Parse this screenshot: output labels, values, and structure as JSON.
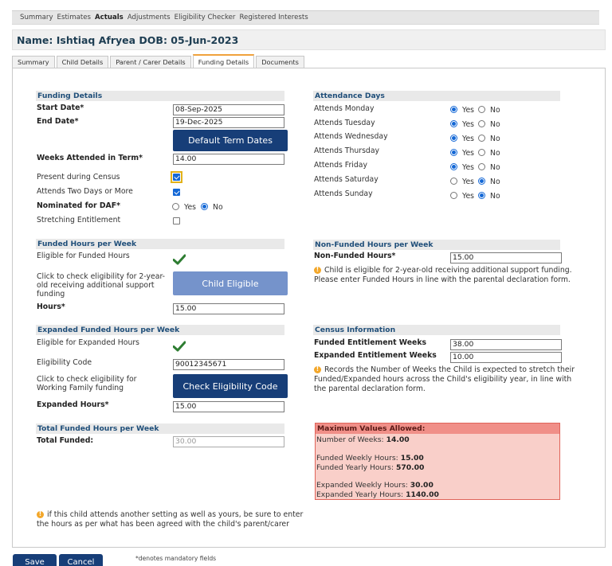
{
  "topnav": [
    "Summary",
    "Estimates",
    "Actuals",
    "Adjustments",
    "Eligibility Checker",
    "Registered Interests"
  ],
  "topnav_active": "Actuals",
  "title": "Name: Ishtiaq Afryea DOB: 05-Jun-2023",
  "tabs": [
    "Summary",
    "Child Details",
    "Parent / Carer Details",
    "Funding Details",
    "Documents"
  ],
  "tab_active": "Funding Details",
  "funding": {
    "header": "Funding Details",
    "start_label": "Start Date*",
    "start_value": "08-Sep-2025",
    "end_label": "End Date*",
    "end_value": "19-Dec-2025",
    "default_btn": "Default Term Dates",
    "weeks_label": "Weeks Attended in Term*",
    "weeks_value": "14.00",
    "census_label": "Present during Census",
    "census_checked": true,
    "twodays_label": "Attends Two Days or More",
    "twodays_checked": true,
    "daf_label": "Nominated for DAF*",
    "daf_yes": "Yes",
    "daf_no": "No",
    "daf_value": "No",
    "stretch_label": "Stretching Entitlement",
    "stretch_checked": false
  },
  "attendance": {
    "header": "Attendance Days",
    "yes_label": "Yes",
    "no_label": "No",
    "days": [
      {
        "label": "Attends Monday",
        "value": "Yes"
      },
      {
        "label": "Attends Tuesday",
        "value": "Yes"
      },
      {
        "label": "Attends Wednesday",
        "value": "Yes"
      },
      {
        "label": "Attends Thursday",
        "value": "Yes"
      },
      {
        "label": "Attends Friday",
        "value": "Yes"
      },
      {
        "label": "Attends Saturday",
        "value": "No"
      },
      {
        "label": "Attends Sunday",
        "value": "No"
      }
    ]
  },
  "funded_hours": {
    "header": "Funded Hours per Week",
    "eligible_label": "Eligible for Funded Hours",
    "check_text": "Click to check eligibility for 2-year-old receiving additional support funding",
    "child_btn": "Child Eligible",
    "hours_label": "Hours*",
    "hours_value": "15.00"
  },
  "non_funded": {
    "header": "Non-Funded Hours per Week",
    "label": "Non-Funded Hours*",
    "value": "15.00",
    "info": "Child is eligible for 2-year-old receiving additional support funding. Please enter Funded Hours in line with the parental declaration form."
  },
  "expanded": {
    "header": "Expanded Funded Hours per Week",
    "eligible_label": "Eligible for Expanded Hours",
    "code_label": "Eligibility Code",
    "code_value": "90012345671",
    "check_text": "Click to check eligibility for Working Family funding",
    "check_btn": "Check Eligibility Code",
    "hours_label": "Expanded Hours*",
    "hours_value": "15.00"
  },
  "census": {
    "header": "Census Information",
    "funded_label": "Funded Entitlement Weeks",
    "funded_value": "38.00",
    "expanded_label": "Expanded Entitlement Weeks",
    "expanded_value": "10.00",
    "info": "Records the Number of Weeks the Child is expected to stretch their Funded/Expanded hours across the Child's eligibility year, in line with the parental declaration form."
  },
  "total": {
    "header": "Total Funded Hours per Week",
    "label": "Total Funded:",
    "value": "30.00"
  },
  "max": {
    "header": "Maximum Values Allowed:",
    "weeks_label": "Number of Weeks:",
    "weeks_value": "14.00",
    "funded_weekly_label": "Funded Weekly Hours:",
    "funded_weekly_value": "15.00",
    "funded_yearly_label": "Funded Yearly Hours:",
    "funded_yearly_value": "570.00",
    "expanded_weekly_label": "Expanded Weekly Hours:",
    "expanded_weekly_value": "30.00",
    "expanded_yearly_label": "Expanded Yearly Hours:",
    "expanded_yearly_value": "1140.00"
  },
  "note": "if this child attends another setting as well as yours, be sure to enter the hours as per what has been agreed with the child's parent/carer",
  "buttons": {
    "save": "Save",
    "cancel": "Cancel"
  },
  "mandatory": "*denotes mandatory fields",
  "colors": {
    "accent": "#173e78",
    "header_text": "#1f4e79",
    "tick": "#2e7d32",
    "warning": "#f3a72a",
    "max_bg": "#f9cfc9"
  }
}
